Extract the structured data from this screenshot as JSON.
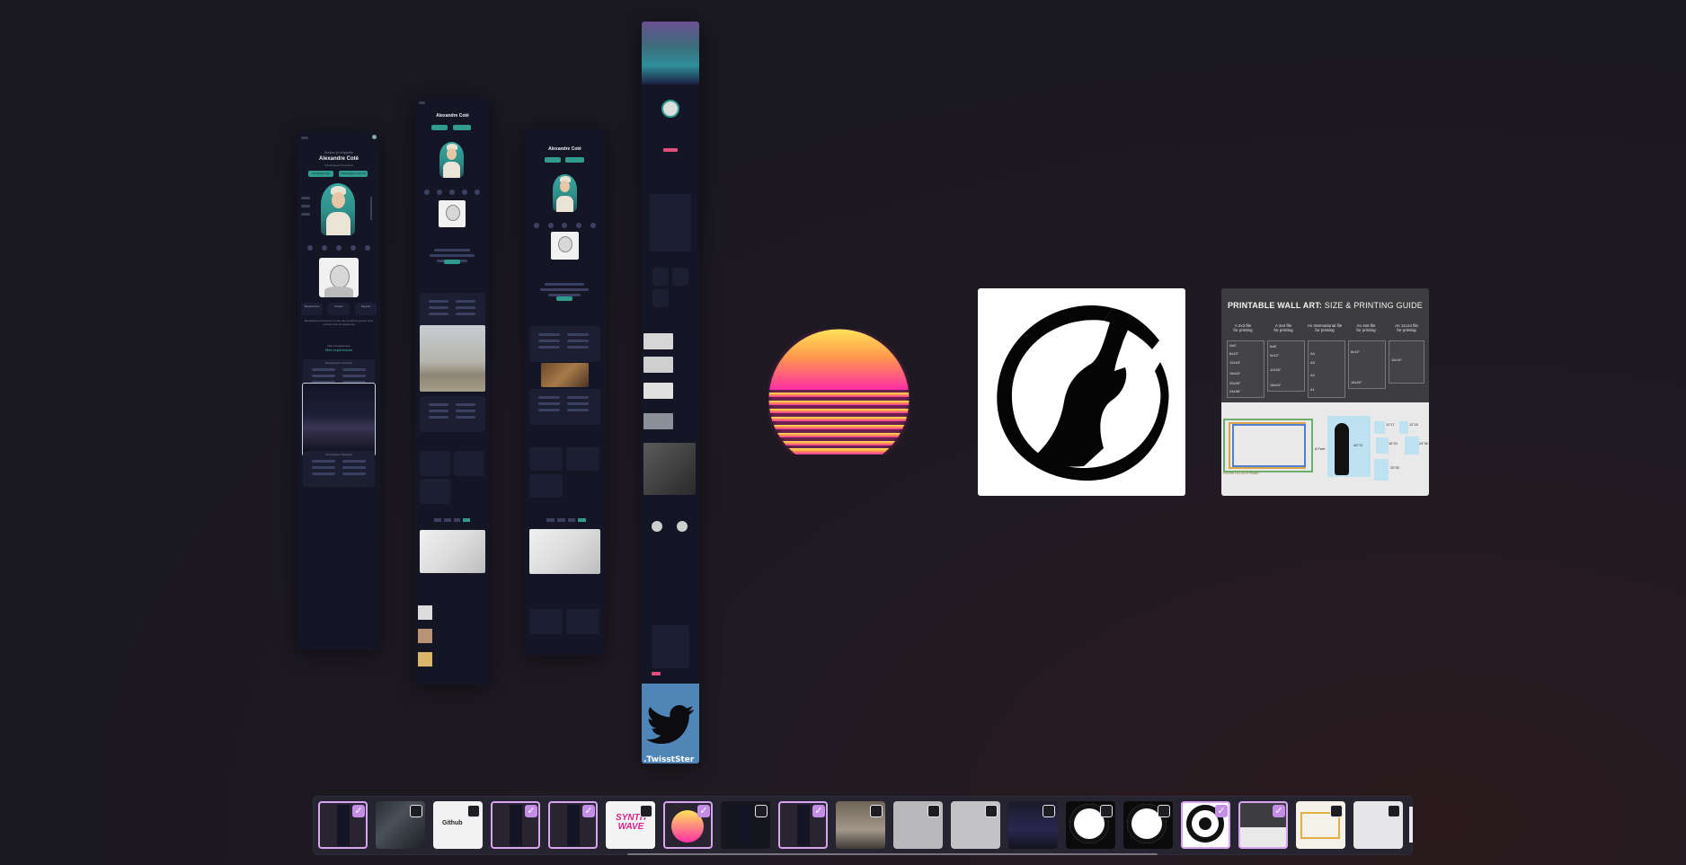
{
  "mockup_a": {
    "greeting": "Bonjour je m'appelle",
    "name": "Alexandre Coté",
    "tagline": "Développeur Front-End",
    "btn_primary": "Contactez-moi",
    "btn_secondary": "Téléchargez mon CV",
    "stats": [
      "Expériences",
      "Projets",
      "Support"
    ],
    "bio": "Développeur Frontend, je crée des projets et je pour vous montrer mes compétences",
    "section_subtitle": "Mes Compétences",
    "section_title": "Mes expériences",
    "card1_title": "Développeur Frontend",
    "card1_items": [
      "HTML",
      "CSS",
      "Bootstrap",
      "SASS",
      "JavaScript",
      "Tailwind"
    ],
    "card2_title": "Développeur Backend",
    "card2_items": [
      "PHP",
      "MySQL",
      "Laravel",
      "Firebase",
      "Node.js",
      "Git"
    ]
  },
  "mockup_d": {
    "brand": ".TwisstSter"
  },
  "guide": {
    "title_bold": "PRINTABLE WALL ART:",
    "title_rest": " SIZE & PRINTING GUIDE",
    "columns": [
      {
        "head": "A 2x3 file",
        "sub": "for printing"
      },
      {
        "head": "A 3x4 file",
        "sub": "for printing"
      },
      {
        "head": "An International file",
        "sub": "for printing"
      },
      {
        "head": "An 4x5 file",
        "sub": "for printing"
      },
      {
        "head": "An 11x14 file",
        "sub": "for printing"
      }
    ],
    "sizes_c1": [
      "4x6\"",
      "8x12\"",
      "12x18\"",
      "16x24\"",
      "20x30\"",
      "24x36\""
    ],
    "sizes_c2": [
      "6x8\"",
      "9x12\"",
      "12x16\"",
      "18x24\""
    ],
    "sizes_c3": [
      "A4",
      "A3",
      "A2",
      "A1"
    ],
    "sizes_c4": [
      "8x10\"",
      "16x20\""
    ],
    "sizes_c5": [
      "11x14\""
    ],
    "bottom_label": "8 Feet",
    "figure_label": "40\"72",
    "small_sizes": [
      "11\"17",
      "12\"18",
      "16\"24",
      "24\"36",
      "20\"30"
    ],
    "legend": "COVER ON 16:9 FRAME"
  },
  "dock": {
    "thumbs": [
      {
        "name": "phone-portfolio-1",
        "checked": true
      },
      {
        "name": "photo-collage",
        "checked": false
      },
      {
        "name": "github-readme",
        "checked": false,
        "text": "Github"
      },
      {
        "name": "phone-portfolio-2",
        "checked": true
      },
      {
        "name": "phone-portfolio-3",
        "checked": true
      },
      {
        "name": "synthwave-logo",
        "checked": true,
        "text": "SYNTH WAVE"
      },
      {
        "name": "sunset-sun",
        "checked": true
      },
      {
        "name": "phone-portfolio-4",
        "checked": false
      },
      {
        "name": "phone-portfolio-5",
        "checked": true
      },
      {
        "name": "person-photo",
        "checked": false
      },
      {
        "name": "document-1",
        "checked": false
      },
      {
        "name": "document-2",
        "checked": false
      },
      {
        "name": "dark-banner",
        "checked": false
      },
      {
        "name": "wolf-logo-1",
        "checked": false
      },
      {
        "name": "wolf-logo-2",
        "checked": false
      },
      {
        "name": "wolf-logo-3",
        "checked": true
      },
      {
        "name": "wall-art-guide-1",
        "checked": true
      },
      {
        "name": "frame-sizes",
        "checked": false
      },
      {
        "name": "wall-art-guide-2",
        "checked": false
      }
    ]
  },
  "colors": {
    "accent": "#2f9c8f",
    "selection": "#c58ee6",
    "sun_top": "#ffe45a",
    "sun_bottom": "#ff2fa6",
    "twitter_blue": "#4f86b7"
  }
}
